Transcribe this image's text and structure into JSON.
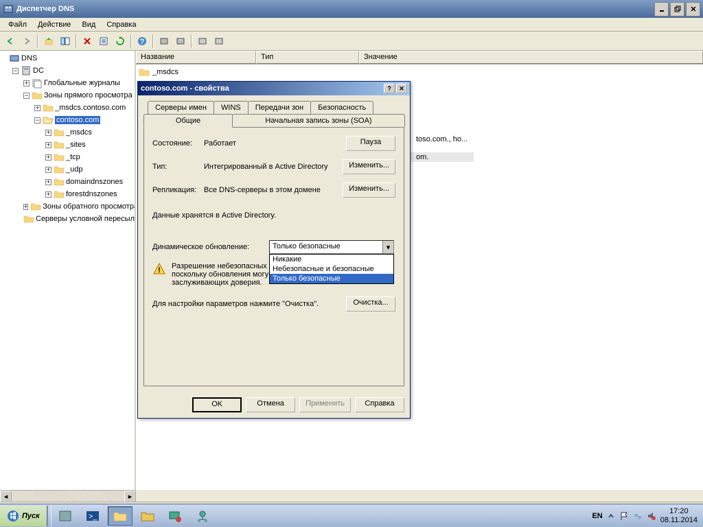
{
  "window": {
    "title": "Диспетчер DNS"
  },
  "menu": [
    "Файл",
    "Действие",
    "Вид",
    "Справка"
  ],
  "cols": {
    "name": "Название",
    "w1": 175,
    "type": "Тип",
    "w2": 150,
    "value": "Значение",
    "w3": 300
  },
  "tree": {
    "root": "DNS",
    "dc": "DC",
    "journals": "Глобальные журналы",
    "fwd": "Зоны прямого просмотра",
    "msdcs_contoso": "_msdcs.contoso.com",
    "contoso": "contoso.com",
    "msdcs": "_msdcs",
    "sites": "_sites",
    "tcp": "_tcp",
    "udp": "_udp",
    "ddz": "domaindnszones",
    "fdz": "forestdnszones",
    "rev": "Зоны обратного просмотра",
    "cond": "Серверы условной пересылки"
  },
  "list": {
    "row1": "_msdcs",
    "row2_val": "toso.com., ho...",
    "row3_val": "om."
  },
  "dialog": {
    "title": "contoso.com - свойства",
    "tabs_row1": [
      "Серверы имен",
      "WINS",
      "Передачи зон",
      "Безопасность"
    ],
    "tabs_row2": [
      "Общие",
      "Начальная запись зоны (SOA)"
    ],
    "state_label": "Состояние:",
    "state_value": "Работает",
    "pause_btn": "Пауза",
    "type_label": "Тип:",
    "type_value": "Интегрированный в Active Directory",
    "change_btn": "Изменить...",
    "repl_label": "Репликация:",
    "repl_value": "Все DNS-серверы в этом домене",
    "stored": "Данные хранятся в Active Directory.",
    "dynupd_label": "Динамическое обновление:",
    "dynupd_value": "Только безопасные",
    "dynupd_options": [
      "Никакие",
      "Небезопасные и безопасные",
      "Только безопасные"
    ],
    "warning_l1": "Разрешение небезопасных",
    "warning_l2": "поскольку обновления могу",
    "warning_l3": "заслуживающих доверия.",
    "cleanup_text": "Для настройки параметров нажмите \"Очистка\".",
    "cleanup_btn": "Очистка...",
    "ok": "OK",
    "cancel": "Отмена",
    "apply": "Применить",
    "help": "Справка"
  },
  "taskbar": {
    "start": "Пуск",
    "lang": "EN",
    "time": "17:20",
    "date": "08.11.2014"
  }
}
